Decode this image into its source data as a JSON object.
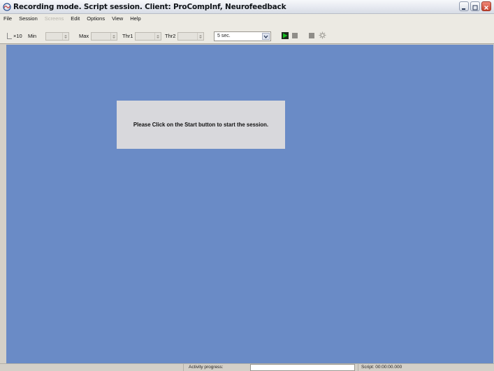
{
  "window": {
    "title": "Recording mode. Script session. Client: ProCompInf, Neurofeedback",
    "app_icon": "app-logo-icon",
    "controls": [
      "minimize-icon",
      "maximize-icon",
      "close-icon"
    ]
  },
  "menubar": {
    "items": [
      {
        "label": "File",
        "enabled": true
      },
      {
        "label": "Session",
        "enabled": true
      },
      {
        "label": "Screens",
        "enabled": false
      },
      {
        "label": "Edit",
        "enabled": true
      },
      {
        "label": "Options",
        "enabled": true
      },
      {
        "label": "View",
        "enabled": true
      },
      {
        "label": "Help",
        "enabled": true
      }
    ]
  },
  "toolbar": {
    "x10_label": "×10",
    "min_label": "Min",
    "max_label": "Max",
    "thr1_label": "Thr1",
    "thr2_label": "Thr2",
    "time_select_value": "5 sec.",
    "buttons": {
      "play": "play-icon",
      "stop": "stop-icon",
      "pause": "pause-icon",
      "settings": "gear-icon"
    },
    "colors": {
      "play": "#14c01f"
    }
  },
  "main": {
    "background": "#6a8bc6",
    "message": "Please Click on the Start button to start the session."
  },
  "statusbar": {
    "activity_label": "Activity progress:",
    "script_time": "Script: 00:00:00.000"
  }
}
